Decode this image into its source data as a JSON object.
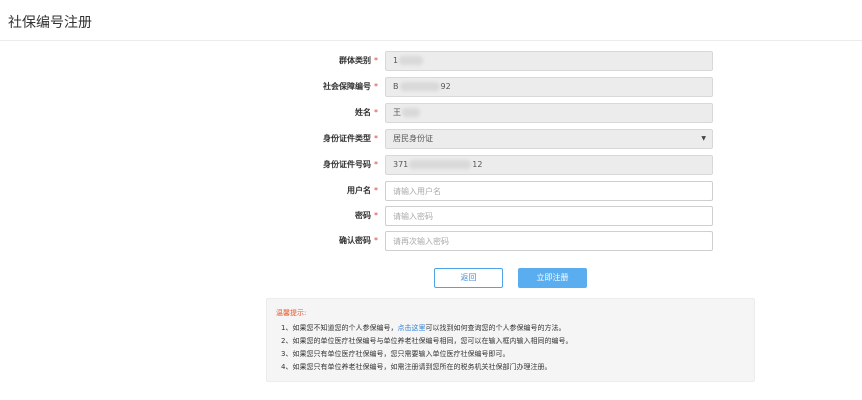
{
  "header": {
    "title": "社保编号注册"
  },
  "form": {
    "group": {
      "label": "群体类别",
      "value_prefix": "1"
    },
    "social_no": {
      "label": "社会保障编号",
      "value_prefix": "B",
      "value_suffix": "92"
    },
    "name": {
      "label": "姓名",
      "value_prefix": "王"
    },
    "id_type": {
      "label": "身份证件类型",
      "value": "居民身份证",
      "arrow": "▼"
    },
    "id_no": {
      "label": "身份证件号码",
      "value_prefix": "371",
      "value_suffix": "12"
    },
    "username": {
      "label": "用户名",
      "placeholder": "请输入用户名"
    },
    "password": {
      "label": "密码",
      "placeholder": "请输入密码"
    },
    "confirm": {
      "label": "确认密码",
      "placeholder": "请再次输入密码"
    },
    "required_mark": "*"
  },
  "buttons": {
    "back": "返回",
    "submit": "立即注册"
  },
  "tips": {
    "title": "温馨提示:",
    "line1_pre": "1、如果您不知道您的个人参保编号，",
    "line1_link": "点击这里",
    "line1_post": "可以找到如何查询您的个人参保编号的方法。",
    "line2": "2、如果您的单位医疗社保编号与单位养老社保编号相同，您可以在输入框内输入相同的编号。",
    "line3": "3、如果您只有单位医疗社保编号，您只需要输入单位医疗社保编号即可。",
    "line4": "4、如果您只有单位养老社保编号，如需注册请到您所在的税务机关社保部门办理注册。"
  },
  "colors": {
    "accent": "#5aaef0",
    "required": "#e23a3a",
    "tips_title": "#e8552a",
    "link": "#2f7fd6"
  }
}
